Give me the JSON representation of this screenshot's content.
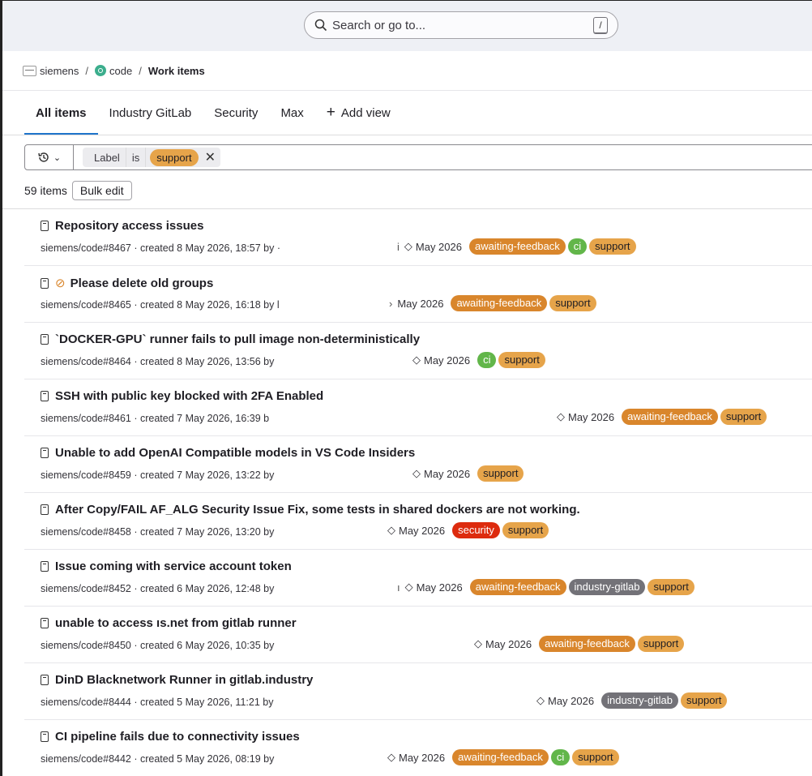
{
  "search": {
    "placeholder": "Search or go to...",
    "shortcut": "/"
  },
  "breadcrumb": {
    "group": "siemens",
    "project": "code",
    "current": "Work items",
    "separator": "/"
  },
  "tabs": [
    {
      "label": "All items",
      "active": true
    },
    {
      "label": "Industry GitLab",
      "active": false
    },
    {
      "label": "Security",
      "active": false
    },
    {
      "label": "Max",
      "active": false
    },
    {
      "label": "Add view",
      "active": false
    }
  ],
  "filter": {
    "field": "Label",
    "operator": "is",
    "value": "support",
    "history_icon": "history-icon"
  },
  "summary": {
    "count": "59 items",
    "bulk_edit": "Bulk edit"
  },
  "label_colors": {
    "awaiting-feedback": "#d9862c",
    "support": "#e6a44a",
    "ci": "#62b64a",
    "security": "#dd2b0e",
    "industry-gitlab": "#737278"
  },
  "items": [
    {
      "confidential": false,
      "title": "Repository access issues",
      "meta": "siemens/code#8467 · created 8 May 2026, 18:57 by ·",
      "lead": "i",
      "milestone": "May 2026",
      "milestone_icon": true,
      "labels": [
        "awaiting-feedback",
        "ci",
        "support"
      ]
    },
    {
      "confidential": true,
      "title": "Please delete old groups",
      "meta": "siemens/code#8465 · created 8 May 2026, 16:18 by l",
      "lead": "›",
      "milestone": "May 2026",
      "milestone_icon": false,
      "labels": [
        "awaiting-feedback",
        "support"
      ]
    },
    {
      "confidential": false,
      "title": "`DOCKER-GPU` runner fails to pull image non-deterministically",
      "meta": "siemens/code#8464 · created 8 May 2026, 13:56 by",
      "lead": "",
      "milestone": "May 2026",
      "milestone_icon": true,
      "labels": [
        "ci",
        "support"
      ]
    },
    {
      "confidential": false,
      "title": "SSH with public key blocked with 2FA Enabled",
      "meta": "siemens/code#8461 · created 7 May 2026, 16:39 b",
      "lead": "",
      "milestone": "May 2026",
      "milestone_icon": true,
      "labels": [
        "awaiting-feedback",
        "support"
      ]
    },
    {
      "confidential": false,
      "title": "Unable to add OpenAI Compatible models in VS Code Insiders",
      "meta": "siemens/code#8459 · created 7 May 2026, 13:22 by",
      "lead": "",
      "milestone": "May 2026",
      "milestone_icon": true,
      "labels": [
        "support"
      ]
    },
    {
      "confidential": false,
      "title": "After Copy/FAIL AF_ALG Security Issue Fix, some tests in shared dockers are not working.",
      "meta": "siemens/code#8458 · created 7 May 2026, 13:20 by",
      "lead": "",
      "milestone": "May 2026",
      "milestone_icon": true,
      "labels": [
        "security",
        "support"
      ]
    },
    {
      "confidential": false,
      "title": "Issue coming with service account token",
      "meta": "siemens/code#8452 · created 6 May 2026, 12:48 by",
      "lead": "ı",
      "milestone": "May 2026",
      "milestone_icon": true,
      "labels": [
        "awaiting-feedback",
        "industry-gitlab",
        "support"
      ]
    },
    {
      "confidential": false,
      "title": "unable to access                       ıs.net from gitlab runner",
      "meta": "siemens/code#8450 · created 6 May 2026, 10:35 by",
      "lead": "",
      "milestone": "May 2026",
      "milestone_icon": true,
      "labels": [
        "awaiting-feedback",
        "support"
      ]
    },
    {
      "confidential": false,
      "title": "DinD Blacknetwork Runner in gitlab.industry",
      "meta": "siemens/code#8444 · created 5 May 2026, 11:21 by",
      "lead": "",
      "milestone": "May 2026",
      "milestone_icon": true,
      "labels": [
        "industry-gitlab",
        "support"
      ]
    },
    {
      "confidential": false,
      "title": "CI pipeline fails due to connectivity issues",
      "meta": "siemens/code#8442 · created 5 May 2026, 08:19 by",
      "lead": "",
      "milestone": "May 2026",
      "milestone_icon": true,
      "labels": [
        "awaiting-feedback",
        "ci",
        "support"
      ]
    }
  ]
}
